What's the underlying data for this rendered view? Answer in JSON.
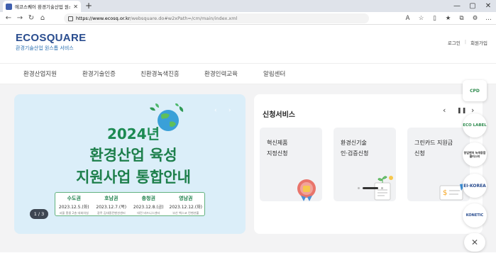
{
  "browser": {
    "tab_title": "에코스퀘어 환경기술산업 원스톱",
    "url_host": "https://www.ecosq.or.kr",
    "url_path": "/websquare.do#w2xPath=/cm/main/index.xml"
  },
  "header": {
    "logo_main": "ECOSQUARE",
    "logo_sub": "환경기술산업 원스톱 서비스",
    "login": "로그인",
    "signup": "회원가입"
  },
  "nav": {
    "items": [
      "환경산업지원",
      "환경기술인증",
      "친환경녹색진흥",
      "환경인력교육",
      "알림센터"
    ]
  },
  "banner": {
    "title1": "2024년",
    "title2": "환경산업 육성",
    "title3": "지원사업 통합안내",
    "regions": [
      {
        "name": "수도권",
        "date": "2023.12.5.(화)",
        "place": "서울 홍릉 2층 대회의실"
      },
      {
        "name": "호남권",
        "date": "2023.12.7.(목)",
        "place": "광주 김대중컨벤션센터"
      },
      {
        "name": "충청권",
        "date": "2023.12.8.(금)",
        "place": "대전 비즈니스센터"
      },
      {
        "name": "영남권",
        "date": "2023.12.12.(화)",
        "place": "부산 벡스코 컨벤션홀"
      }
    ],
    "pager": "1 / 3"
  },
  "services": {
    "heading": "신청서비스",
    "cards": [
      {
        "line1": "혁신제품",
        "line2": "지정신청"
      },
      {
        "line1": "환경신기술",
        "line2": "인·검증신청"
      },
      {
        "line1": "그린카드 지원금",
        "line2": "신청"
      }
    ]
  },
  "quick_menu": {
    "items": [
      "CPD",
      "ECO LABEL",
      "창업벤처 녹색융합 클러스터",
      "EI-KOREA",
      "KONETIC"
    ]
  },
  "colors": {
    "brand": "#2a4d8f",
    "banner_green": "#1d7f4b",
    "banner_bg": "#dbeef9"
  }
}
